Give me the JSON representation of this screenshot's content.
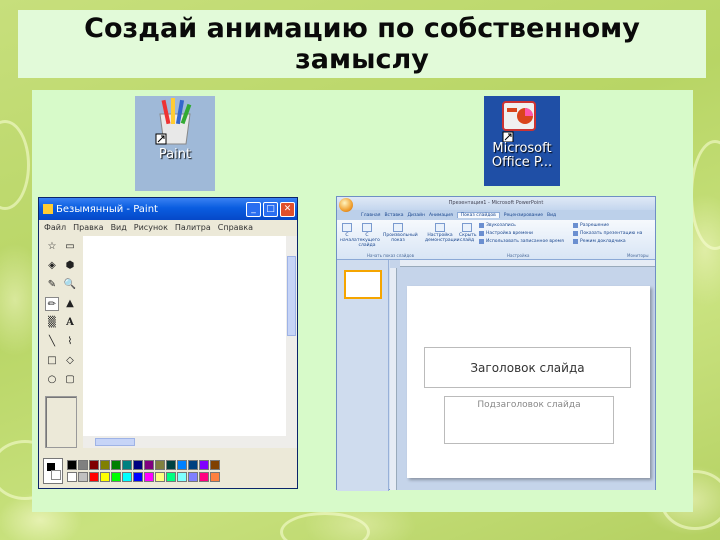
{
  "heading": "Создай анимацию по собственному замыслу",
  "icons": {
    "paint_label": "Paint",
    "powerpoint_label_line1": "Microsoft",
    "powerpoint_label_line2": "Office P..."
  },
  "paint_window": {
    "title": "Безымянный - Paint",
    "menu": [
      "Файл",
      "Правка",
      "Вид",
      "Рисунок",
      "Палитра",
      "Справка"
    ],
    "tools": [
      "☆",
      "▭",
      "◈",
      "⬢",
      "✎",
      "🔍",
      "✏",
      "▲",
      "▒",
      "A",
      "╲",
      "⌇",
      "□",
      "◇",
      "○",
      "▢"
    ],
    "palette_colors": [
      "#000000",
      "#808080",
      "#800000",
      "#808000",
      "#008000",
      "#008080",
      "#000080",
      "#800080",
      "#808040",
      "#004040",
      "#0080ff",
      "#004080",
      "#8000ff",
      "#804000",
      "#ffffff",
      "#c0c0c0",
      "#ff0000",
      "#ffff00",
      "#00ff00",
      "#00ffff",
      "#0000ff",
      "#ff00ff",
      "#ffff80",
      "#00ff80",
      "#80ffff",
      "#8080ff",
      "#ff0080",
      "#ff8040"
    ]
  },
  "powerpoint_window": {
    "title": "Презентация1 - Microsoft PowerPoint",
    "tabs": [
      "Главная",
      "Вставка",
      "Дизайн",
      "Анимация",
      "Показ слайдов",
      "Рецензирование",
      "Вид"
    ],
    "selected_tab": "Показ слайдов",
    "ribbon_buttons": [
      "С начала",
      "С текущего слайда",
      "Произвольный показ",
      "Настройка демонстрации",
      "Скрыть слайд"
    ],
    "ribbon_group_1": "Начать показ слайдов",
    "ribbon_group_2": "Настройка",
    "ribbon_group_3": "Мониторы",
    "options": [
      "Звукозапись",
      "Настройка времени",
      "Использовать записанное время"
    ],
    "monitor_options": [
      "Разрешение",
      "Показать презентацию на",
      "Режим докладчика"
    ],
    "slide_title_placeholder": "Заголовок слайда",
    "slide_subtitle_placeholder": "Подзаголовок слайда"
  }
}
